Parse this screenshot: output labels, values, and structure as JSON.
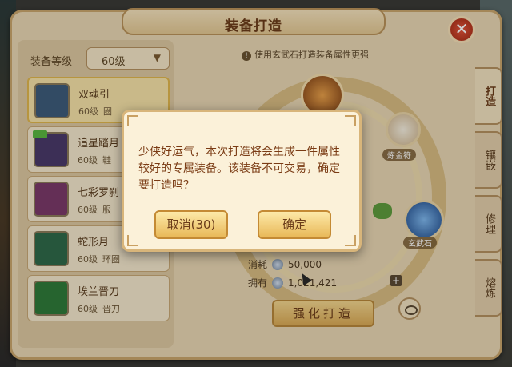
{
  "window": {
    "title": "装备打造",
    "close_icon": "close-icon"
  },
  "filter": {
    "label": "装备等级",
    "selected": "60级"
  },
  "items": [
    {
      "name": "双魂引",
      "level": "60级",
      "type": "圈",
      "thumb_color": "#3d5c7a"
    },
    {
      "name": "追星踏月",
      "level": "60级",
      "type": "鞋",
      "thumb_color": "#4a3a6a"
    },
    {
      "name": "七彩罗刹",
      "level": "60级",
      "type": "服",
      "thumb_color": "#7a3a6a"
    },
    {
      "name": "蛇形月",
      "level": "60级",
      "type": "环圈",
      "thumb_color": "#2f6a4a"
    },
    {
      "name": "埃兰晋刀",
      "level": "60级",
      "type": "晋刀",
      "thumb_color": "#2f7a3a"
    }
  ],
  "main": {
    "tip": "使用玄武石打造装备属性更强",
    "slots": {
      "bag_label": "炼金符",
      "stone_label": "玄武石"
    },
    "cost_label": "消耗",
    "cost_value": "50,000",
    "own_label": "拥有",
    "own_value": "1,021,421",
    "forge_button": "强化打造"
  },
  "side_tabs": [
    "打造",
    "镶嵌",
    "修理",
    "熔炼"
  ],
  "dialog": {
    "message": "少侠好运气，本次打造将会生成一件属性较好的专属装备。该装备不可交易，确定要打造吗？",
    "cancel_label": "取消(30)",
    "confirm_label": "确定"
  }
}
